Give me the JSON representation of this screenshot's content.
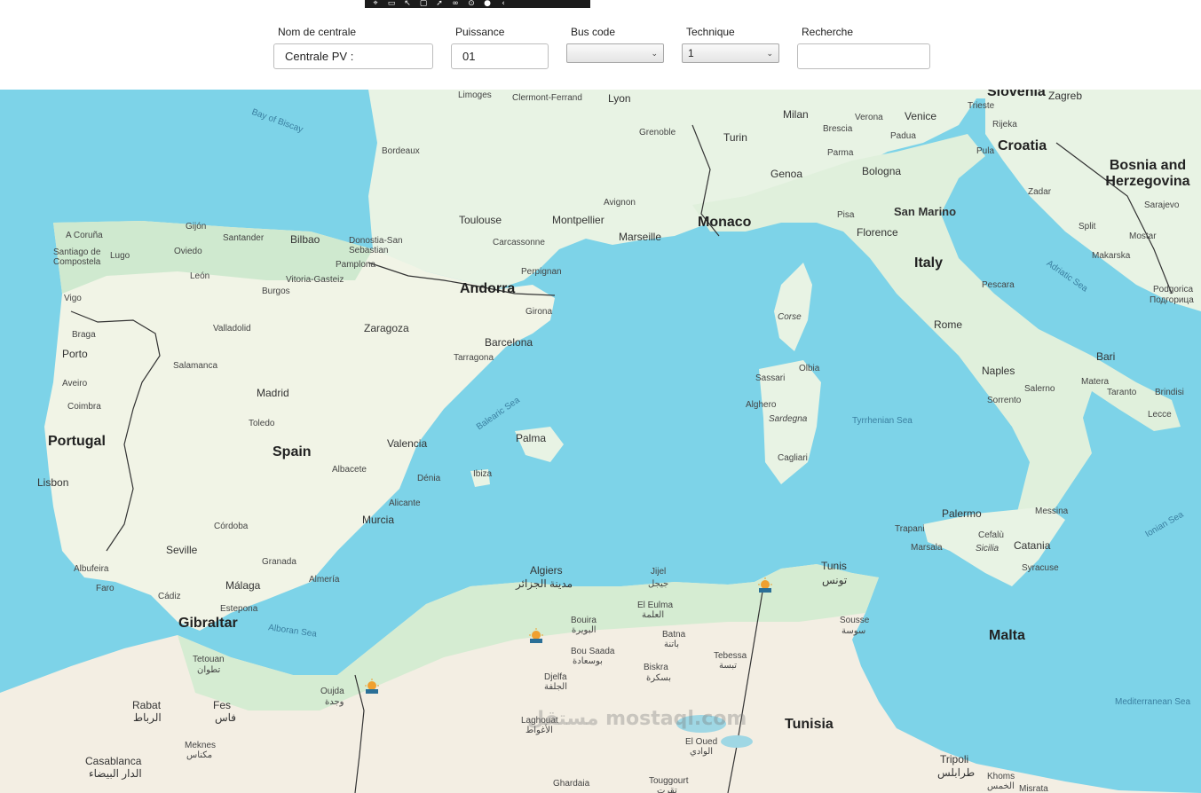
{
  "form": {
    "nom_label": "Nom de centrale",
    "nom_value": "Centrale PV :",
    "puissance_label": "Puissance",
    "puissance_value": "01",
    "bus_label": "Bus code",
    "bus_value": "",
    "technique_label": "Technique",
    "technique_value": "1",
    "recherche_label": "Recherche",
    "recherche_value": ""
  },
  "map": {
    "countries": [
      "Portugal",
      "Spain",
      "Andorra",
      "Monaco",
      "Italy",
      "Croatia",
      "Bosnia and Herzegovina",
      "Tunisia",
      "Malta",
      "Slovenia",
      "San Marino",
      "Gibraltar"
    ],
    "seas": [
      "Bay of Biscay",
      "Balearic Sea",
      "Alboran Sea",
      "Tyrrhenian Sea",
      "Adriatic Sea",
      "Ionian Sea",
      "Mediterranean Sea"
    ],
    "cities": [
      "Limoges",
      "Clermont-Ferrand",
      "Lyon",
      "Grenoble",
      "Bordeaux",
      "Toulouse",
      "Montpellier",
      "Marseille",
      "Avignon",
      "Carcassonne",
      "Perpignan",
      "Turin",
      "Milan",
      "Genoa",
      "Verona",
      "Venice",
      "Brescia",
      "Padua",
      "Parma",
      "Bologna",
      "Pisa",
      "Florence",
      "Trieste",
      "Zagreb",
      "Rijeka",
      "Pula",
      "Zadar",
      "Split",
      "Sarajevo",
      "Mostar",
      "Makarska",
      "Podgorica",
      "Подгорица",
      "Pescara",
      "Rome",
      "Naples",
      "Salerno",
      "Sorrento",
      "Bari",
      "Matera",
      "Taranto",
      "Brindisi",
      "Lecce",
      "Messina",
      "Palermo",
      "Trapani",
      "Marsala",
      "Cefalù",
      "Sicilia",
      "Catania",
      "Syracuse",
      "Corse",
      "Sassari",
      "Olbia",
      "Alghero",
      "Sardegna",
      "Cagliari",
      "A Coruña",
      "Santiago de Compostela",
      "Lugo",
      "Gijón",
      "Oviedo",
      "Santander",
      "Bilbao",
      "Donostia-San Sebastian",
      "Pamplona",
      "Vitoria-Gasteiz",
      "Burgos",
      "León",
      "Vigo",
      "Braga",
      "Porto",
      "Aveiro",
      "Coimbra",
      "Lisbon",
      "Valladolid",
      "Salamanca",
      "Madrid",
      "Toledo",
      "Zaragoza",
      "Barcelona",
      "Girona",
      "Tarragona",
      "Valencia",
      "Albacete",
      "Dénia",
      "Alicante",
      "Murcia",
      "Córdoba",
      "Seville",
      "Granada",
      "Almería",
      "Málaga",
      "Cádiz",
      "Estepona",
      "Albufeira",
      "Faro",
      "Palma",
      "Ibiza",
      "Tetouan",
      "تطوان",
      "Rabat",
      "الرباط",
      "Fes",
      "فاس",
      "Meknes",
      "مكناس",
      "Casablanca",
      "الدار البيضاء",
      "Oujda",
      "وجدة",
      "Algiers",
      "مدينة الجزائر",
      "Jijel",
      "جيجل",
      "Bouira",
      "البويرة",
      "El Eulma",
      "العلمة",
      "Batna",
      "باتنة",
      "Bou Saada",
      "بوسعادة",
      "Djelfa",
      "الجلفة",
      "Biskra",
      "بسكرة",
      "Tebessa",
      "تبسة",
      "Laghouat",
      "الأغواط",
      "El Oued",
      "الوادي",
      "Touggourt",
      "تقرت",
      "Ghardaia",
      "Tunis",
      "تونس",
      "Sousse",
      "سوسة",
      "Tripoli",
      "طرابلس",
      "Khoms",
      "الخمس",
      "Misrata"
    ],
    "watermark": "مستقل mostaql.com"
  },
  "colors": {
    "sea": "#7dd3e8",
    "land": "#e8f3e4",
    "land_green": "#bfe3c6",
    "desert": "#f3eee3",
    "marker": "#f0a030"
  }
}
